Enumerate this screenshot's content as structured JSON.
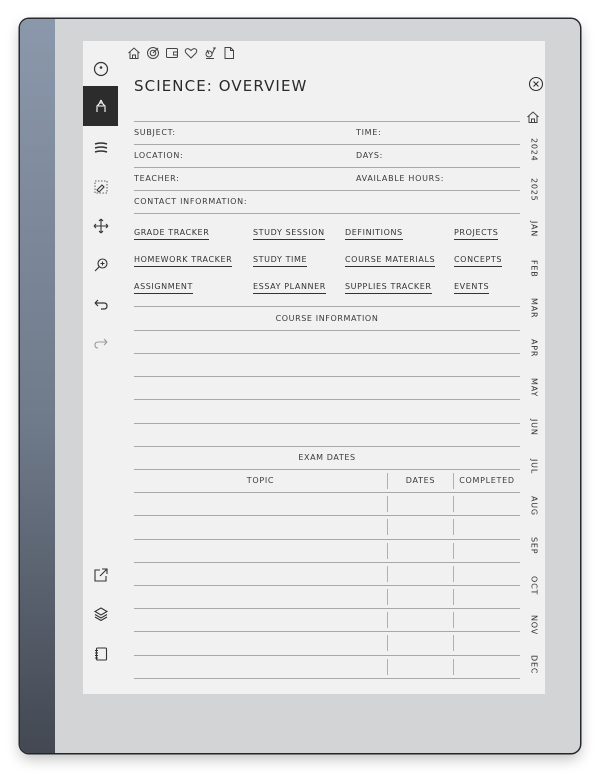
{
  "page": {
    "title": "SCIENCE: OVERVIEW"
  },
  "toolbar": {
    "tools": [
      {
        "name": "menu-circle"
      },
      {
        "name": "pen"
      },
      {
        "name": "lines"
      },
      {
        "name": "eraser"
      },
      {
        "name": "move"
      },
      {
        "name": "zoom"
      },
      {
        "name": "undo"
      },
      {
        "name": "redo"
      },
      {
        "name": "share"
      },
      {
        "name": "layers"
      },
      {
        "name": "notebook"
      }
    ],
    "active_tool": "pen"
  },
  "top_icons": [
    "home-icon",
    "target-icon",
    "wallet-icon",
    "heart-icon",
    "exercise-bike-icon",
    "document-icon"
  ],
  "info_fields": {
    "subject": "SUBJECT:",
    "time": "TIME:",
    "location": "LOCATION:",
    "days": "DAYS:",
    "teacher": "TEACHER:",
    "available_hours": "AVAILABLE HOURS:",
    "contact": "CONTACT INFORMATION:"
  },
  "links": [
    [
      "GRADE TRACKER",
      "STUDY SESSION",
      "DEFINITIONS",
      "PROJECTS"
    ],
    [
      "HOMEWORK TRACKER",
      "STUDY TIME",
      "COURSE MATERIALS",
      "CONCEPTS"
    ],
    [
      "ASSIGNMENT",
      "ESSAY PLANNER",
      "SUPPLIES TRACKER",
      "EVENTS"
    ]
  ],
  "course_info": {
    "heading": "COURSE INFORMATION"
  },
  "exam_dates": {
    "heading": "EXAM DATES",
    "columns": [
      "TOPIC",
      "DATES",
      "COMPLETED"
    ],
    "row_count": 8
  },
  "side_tabs": [
    "2024",
    "2025",
    "JAN",
    "FEB",
    "MAR",
    "APR",
    "MAY",
    "JUN",
    "JUL",
    "AUG",
    "SEP",
    "OCT",
    "NOV",
    "DEC"
  ]
}
